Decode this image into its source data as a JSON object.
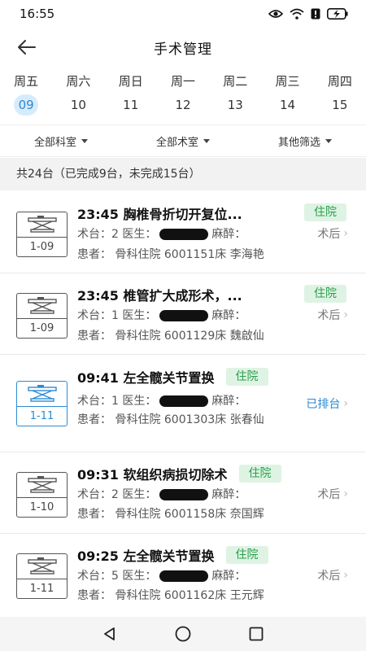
{
  "status_bar": {
    "time": "16:55"
  },
  "header": {
    "title": "手术管理"
  },
  "dates": [
    {
      "weekday": "周五",
      "day": "09"
    },
    {
      "weekday": "周六",
      "day": "10"
    },
    {
      "weekday": "周日",
      "day": "11"
    },
    {
      "weekday": "周一",
      "day": "12"
    },
    {
      "weekday": "周二",
      "day": "13"
    },
    {
      "weekday": "周三",
      "day": "14"
    },
    {
      "weekday": "周四",
      "day": "15"
    }
  ],
  "filters": {
    "department": "全部科室",
    "room": "全部术室",
    "other": "其他筛选"
  },
  "summary": "共24台（已完成9台，未完成15台）",
  "items": [
    {
      "date": "1-09",
      "title": "23:45 胸椎骨折切开复位...",
      "badge": "住院",
      "meta_a": "术台：2 医生：",
      "meta_b": "麻醉：",
      "status": "术后",
      "patient": "患者：  骨科住院 6001151床 李海艳"
    },
    {
      "date": "1-09",
      "title": "23:45 椎管扩大成形术，...",
      "badge": "住院",
      "meta_a": "术台：1 医生：",
      "meta_b": "麻醉：",
      "status": "术后",
      "patient": "患者：  骨科住院 6001129床 魏啟仙"
    },
    {
      "date": "1-11",
      "title": "09:41 左全髋关节置换",
      "badge": "住院",
      "meta_a": "术台：1 医生：",
      "meta_b": "麻醉：",
      "status": "已排台",
      "patient": "患者：  骨科住院 6001303床 张春仙"
    },
    {
      "date": "1-10",
      "title": "09:31 软组织病损切除术",
      "badge": "住院",
      "meta_a": "术台：2 医生：",
      "meta_b": "麻醉：",
      "status": "术后",
      "patient": "患者：  骨科住院 6001158床 奈国辉"
    },
    {
      "date": "1-11",
      "title": "09:25 左全髋关节置换",
      "badge": "住院",
      "meta_a": "术台：5 医生：",
      "meta_b": "麻醉：",
      "status": "术后",
      "patient": "患者：  骨科住院 6001162床 王元辉"
    }
  ],
  "colors": {
    "accent": "#2a8ad4",
    "badge_bg": "#dff3e4",
    "badge_text": "#27a04a"
  }
}
